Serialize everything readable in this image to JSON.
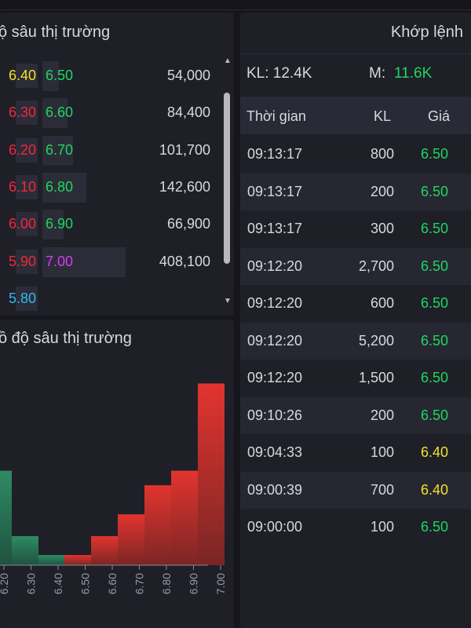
{
  "depth": {
    "title": "ộ sâu thị trường",
    "rows": [
      {
        "bid": "6.40",
        "bid_color": "yellow",
        "ask": "6.50",
        "ask_color": "green",
        "volume": "54,000"
      },
      {
        "bid": "6.30",
        "bid_color": "red",
        "ask": "6.60",
        "ask_color": "green",
        "volume": "84,400"
      },
      {
        "bid": "6.20",
        "bid_color": "red",
        "ask": "6.70",
        "ask_color": "green",
        "volume": "101,700"
      },
      {
        "bid": "6.10",
        "bid_color": "red",
        "ask": "6.80",
        "ask_color": "green",
        "volume": "142,600"
      },
      {
        "bid": "6.00",
        "bid_color": "red",
        "ask": "6.90",
        "ask_color": "green",
        "volume": "66,900"
      },
      {
        "bid": "5.90",
        "bid_color": "red",
        "ask": "7.00",
        "ask_color": "purple",
        "volume": "408,100"
      },
      {
        "bid": "5.80",
        "bid_color": "cyan",
        "ask": "",
        "ask_color": "green",
        "volume": ""
      }
    ],
    "ask_bar_fractions": [
      0.2,
      0.3,
      0.37,
      0.53,
      0.25,
      1.0,
      0
    ]
  },
  "chart": {
    "title": "ồ độ sâu thị trường"
  },
  "chart_data": {
    "type": "bar",
    "title": "ồ độ sâu thị trường",
    "categories": [
      "6.20",
      "6.30",
      "6.40",
      "6.50",
      "6.60",
      "6.70",
      "6.80",
      "6.90",
      "7.00"
    ],
    "series": [
      {
        "color": "#2e8b64",
        "values": [
          130000,
          40000,
          14000,
          0,
          0,
          0,
          0,
          0,
          0
        ]
      },
      {
        "color": "#d9302e",
        "values": [
          0,
          0,
          0,
          14000,
          40000,
          70000,
          110000,
          130000,
          250000
        ]
      }
    ],
    "hidden_left_values": [
      130000,
      40000
    ],
    "ylim": [
      0,
      270000
    ]
  },
  "match": {
    "title": "Khớp lệnh",
    "kl_label": "KL: 12.4K",
    "m_label": "M:",
    "m_value": "11.6K",
    "headers": {
      "time": "Thời gian",
      "vol": "KL",
      "price": "Giá"
    },
    "rows": [
      {
        "time": "09:13:17",
        "vol": "800",
        "price": "6.50",
        "color": "green"
      },
      {
        "time": "09:13:17",
        "vol": "200",
        "price": "6.50",
        "color": "green"
      },
      {
        "time": "09:13:17",
        "vol": "300",
        "price": "6.50",
        "color": "green"
      },
      {
        "time": "09:12:20",
        "vol": "2,700",
        "price": "6.50",
        "color": "green"
      },
      {
        "time": "09:12:20",
        "vol": "600",
        "price": "6.50",
        "color": "green"
      },
      {
        "time": "09:12:20",
        "vol": "5,200",
        "price": "6.50",
        "color": "green"
      },
      {
        "time": "09:12:20",
        "vol": "1,500",
        "price": "6.50",
        "color": "green"
      },
      {
        "time": "09:10:26",
        "vol": "200",
        "price": "6.50",
        "color": "green"
      },
      {
        "time": "09:04:33",
        "vol": "100",
        "price": "6.40",
        "color": "yellow"
      },
      {
        "time": "09:00:39",
        "vol": "700",
        "price": "6.40",
        "color": "yellow"
      },
      {
        "time": "09:00:00",
        "vol": "100",
        "price": "6.50",
        "color": "green"
      }
    ]
  },
  "colors": {
    "green": "#1ed760",
    "red": "#f0283c",
    "yellow": "#f2e12a",
    "purple": "#d13df0",
    "cyan": "#30b8f0"
  }
}
